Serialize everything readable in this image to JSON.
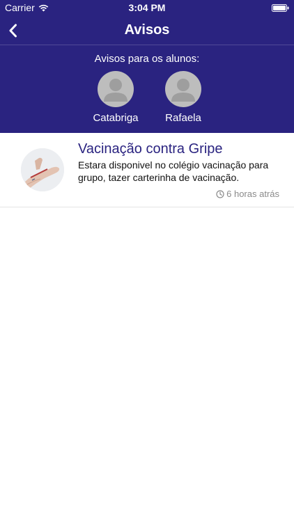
{
  "status_bar": {
    "carrier": "Carrier",
    "time": "3:04 PM"
  },
  "nav": {
    "title": "Avisos",
    "back_icon": "chevron-left-icon"
  },
  "students": {
    "label": "Avisos para os alunos:",
    "items": [
      {
        "name": "Catabriga",
        "icon": "person-avatar-icon"
      },
      {
        "name": "Rafaela",
        "icon": "person-avatar-icon"
      }
    ]
  },
  "notices": [
    {
      "title": "Vacinação contra Gripe",
      "body": "Estara disponivel no colégio vacinação para grupo, tazer carterinha de vacinação.",
      "time": "6 horas atrás",
      "time_icon": "clock-icon"
    }
  ],
  "colors": {
    "primary": "#2a2380",
    "avatar_placeholder": "#bdbdbd",
    "muted_text": "#8a8a8a"
  }
}
